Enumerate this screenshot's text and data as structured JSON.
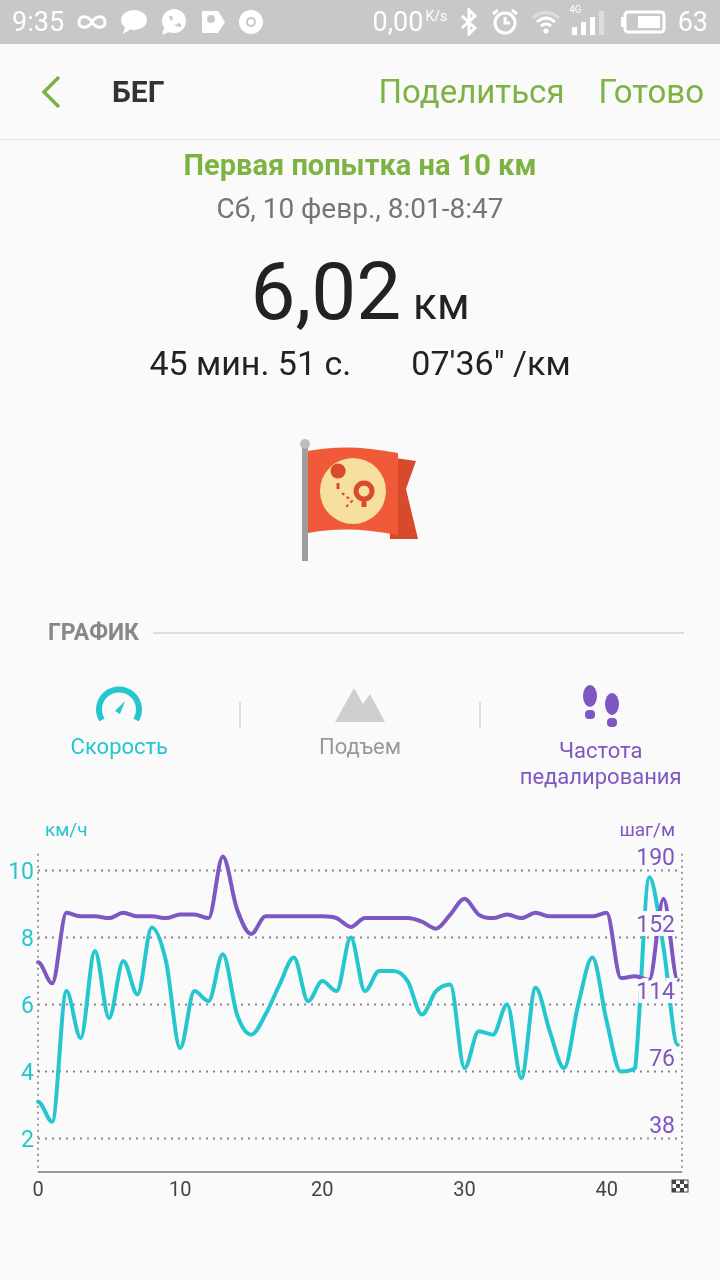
{
  "status_bar": {
    "time": "9:35",
    "speed": "0,00",
    "speed_unit": "K/s",
    "network": "4G",
    "battery": "63"
  },
  "header": {
    "title": "БЕГ",
    "actions": [
      "Поделиться",
      "Готово"
    ]
  },
  "workout": {
    "name": "Первая попытка на 10 км",
    "date": "Сб, 10 февр., 8:01-8:47",
    "distance": "6,02",
    "distance_unit": "км",
    "duration": "45 мин. 51 с.",
    "pace": "07'36\" /км"
  },
  "section": {
    "title": "ГРАФИК"
  },
  "tabs": [
    {
      "label": "Скорость",
      "kind": "speedometer",
      "on": true,
      "color": "#26c6cf"
    },
    {
      "label": "Подъем",
      "kind": "mountain",
      "on": false,
      "color": "#8f8f8f"
    },
    {
      "label": "Частота педалирования",
      "kind": "footprints",
      "on": true,
      "color": "#7e57c2"
    }
  ],
  "chart_data": {
    "type": "line",
    "xlim": [
      0,
      45.3
    ],
    "ylabel": "км/ч",
    "y2label": "шаг/м",
    "x": [
      0,
      1,
      2,
      3,
      4,
      5,
      6,
      7,
      8,
      9,
      10,
      11,
      12,
      13,
      14,
      15,
      16,
      17,
      18,
      19,
      20,
      21,
      22,
      23,
      24,
      25,
      26,
      27,
      28,
      29,
      30,
      31,
      32,
      33,
      34,
      35,
      36,
      37,
      38,
      39,
      40,
      41,
      42,
      43,
      44,
      45
    ],
    "xticks": [
      0,
      10,
      20,
      30,
      40
    ],
    "grid": true,
    "ylim": [
      1,
      10.5
    ],
    "yticks": [
      2,
      4,
      6,
      8,
      10
    ],
    "y2lim": [
      19,
      199.5
    ],
    "y2ticks": [
      38,
      76,
      114,
      152,
      190
    ],
    "series": [
      {
        "color": "#26c6cf",
        "axis": "y",
        "values": [
          3.1,
          2.5,
          6.4,
          5.0,
          7.6,
          5.6,
          7.3,
          6.3,
          8.3,
          7.3,
          4.7,
          6.4,
          6.1,
          7.5,
          5.7,
          5.1,
          5.7,
          6.6,
          7.4,
          6.1,
          6.7,
          6.4,
          8.0,
          6.4,
          7.0,
          7.0,
          6.7,
          5.7,
          6.4,
          6.6,
          4.1,
          5.2,
          5.1,
          6.0,
          3.8,
          6.5,
          5.2,
          4.1,
          6.0,
          7.4,
          5.5,
          4.0,
          4.1,
          9.8,
          7.7,
          4.8
        ]
      },
      {
        "color": "#7e57c2",
        "axis": "y2",
        "values": [
          138,
          126,
          166,
          164,
          164,
          163,
          166,
          164,
          164,
          163,
          165,
          165,
          163,
          198,
          168,
          154,
          164,
          164,
          164,
          164,
          164,
          163,
          158,
          163,
          163,
          163,
          163,
          161,
          157,
          165,
          174,
          165,
          163,
          165,
          163,
          166,
          164,
          164,
          164,
          164,
          166,
          129,
          130,
          128,
          174,
          128
        ]
      }
    ]
  }
}
